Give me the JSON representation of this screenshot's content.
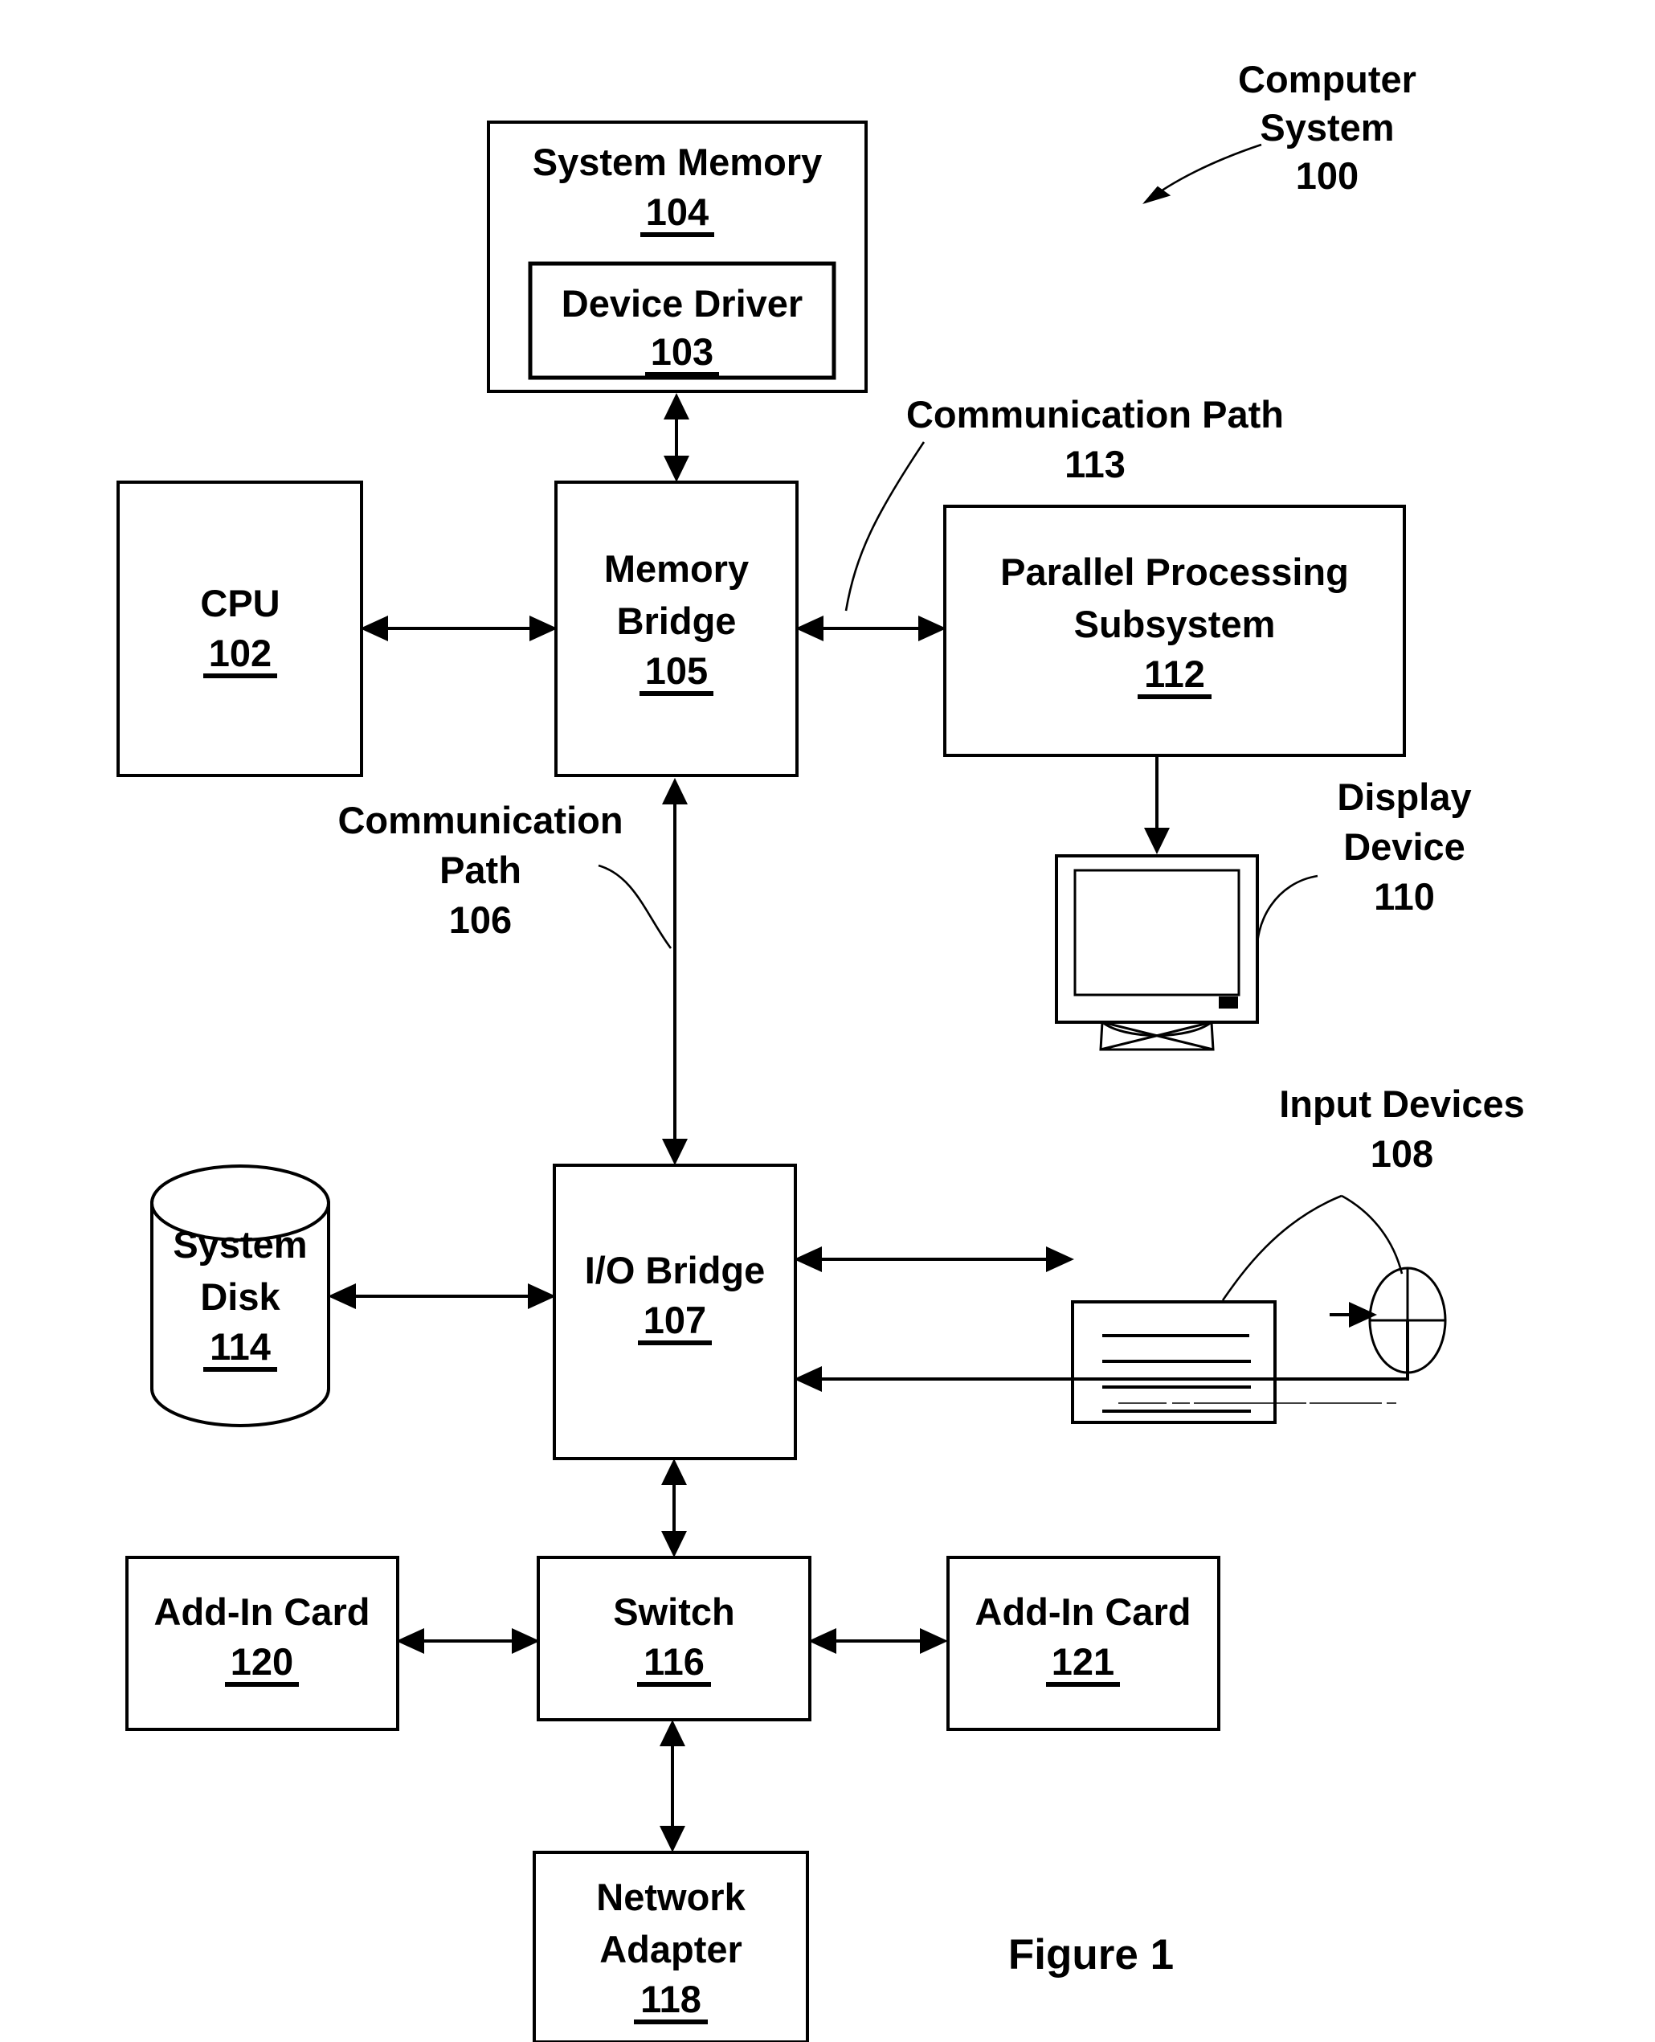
{
  "figure": {
    "caption": "Figure 1",
    "system_label": {
      "line1": "Computer",
      "line2": "System",
      "ref": "100"
    }
  },
  "blocks": {
    "system_memory": {
      "title": "System Memory",
      "ref": "104"
    },
    "device_driver": {
      "title": "Device Driver",
      "ref": "103"
    },
    "cpu": {
      "title": "CPU",
      "ref": "102"
    },
    "memory_bridge": {
      "line1": "Memory",
      "line2": "Bridge",
      "ref": "105"
    },
    "parallel_processing_subsystem": {
      "line1": "Parallel Processing",
      "line2": "Subsystem",
      "ref": "112"
    },
    "io_bridge": {
      "title": "I/O Bridge",
      "ref": "107"
    },
    "system_disk": {
      "line1": "System",
      "line2": "Disk",
      "ref": "114"
    },
    "switch": {
      "title": "Switch",
      "ref": "116"
    },
    "add_in_card_left": {
      "title": "Add-In Card",
      "ref": "120"
    },
    "add_in_card_right": {
      "title": "Add-In Card",
      "ref": "121"
    },
    "network_adapter": {
      "line1": "Network",
      "line2": "Adapter",
      "ref": "118"
    }
  },
  "annotations": {
    "comm_path_113": {
      "line1": "Communication Path",
      "ref": "113"
    },
    "comm_path_106": {
      "line1": "Communication",
      "line2": "Path",
      "ref": "106"
    },
    "display_device": {
      "line1": "Display",
      "line2": "Device",
      "ref": "110"
    },
    "input_devices": {
      "line1": "Input Devices",
      "ref": "108"
    }
  },
  "icons": {
    "display_device": "monitor-icon",
    "keyboard": "keyboard-icon",
    "mouse": "mouse-icon",
    "system_disk": "cylinder-database-icon"
  },
  "colors": {
    "ink": "#000000",
    "paper": "#ffffff"
  }
}
